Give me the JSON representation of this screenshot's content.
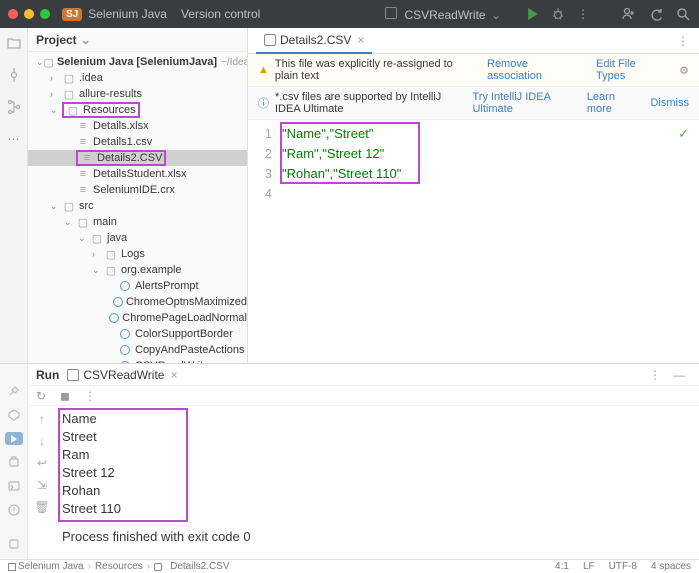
{
  "titlebar": {
    "badge": "SJ",
    "project": "Selenium Java",
    "vcs": "Version control",
    "run_config": "CSVReadWrite"
  },
  "project": {
    "header": "Project",
    "root_name": "Selenium Java",
    "root_module": "[SeleniumJava]",
    "root_path": "~/IdeaProjects/S",
    "tree": [
      {
        "lvl": 1,
        "arrow": ">",
        "type": "folder",
        "label": ".idea"
      },
      {
        "lvl": 1,
        "arrow": ">",
        "type": "folder",
        "label": "allure-results"
      },
      {
        "lvl": 1,
        "arrow": "v",
        "type": "folder",
        "label": "Resources",
        "hl": true
      },
      {
        "lvl": 2,
        "arrow": "",
        "type": "file",
        "label": "Details.xlsx"
      },
      {
        "lvl": 2,
        "arrow": "",
        "type": "file",
        "label": "Details1.csv"
      },
      {
        "lvl": 2,
        "arrow": "",
        "type": "file",
        "label": "Details2.CSV",
        "selected": true,
        "hl": true
      },
      {
        "lvl": 2,
        "arrow": "",
        "type": "file",
        "label": "DetailsStudent.xlsx"
      },
      {
        "lvl": 2,
        "arrow": "",
        "type": "file",
        "label": "SeleniumIDE.crx"
      },
      {
        "lvl": 1,
        "arrow": "v",
        "type": "folder",
        "label": "src"
      },
      {
        "lvl": 2,
        "arrow": "v",
        "type": "folder",
        "label": "main"
      },
      {
        "lvl": 3,
        "arrow": "v",
        "type": "folder",
        "label": "java"
      },
      {
        "lvl": 4,
        "arrow": ">",
        "type": "pkg",
        "label": "Logs"
      },
      {
        "lvl": 4,
        "arrow": "v",
        "type": "pkg",
        "label": "org.example"
      },
      {
        "lvl": 5,
        "arrow": "",
        "type": "java",
        "label": "AlertsPrompt"
      },
      {
        "lvl": 5,
        "arrow": "",
        "type": "java",
        "label": "ChromeOptnsMaximized"
      },
      {
        "lvl": 5,
        "arrow": "",
        "type": "java",
        "label": "ChromePageLoadNormal"
      },
      {
        "lvl": 5,
        "arrow": "",
        "type": "java",
        "label": "ColorSupportBorder"
      },
      {
        "lvl": 5,
        "arrow": "",
        "type": "java",
        "label": "CopyAndPasteActions"
      },
      {
        "lvl": 5,
        "arrow": "",
        "type": "java",
        "label": "CSVReadWrite"
      }
    ]
  },
  "editor": {
    "tab_name": "Details2.CSV",
    "banner_warn": "This file was explicitly re-assigned to plain text",
    "banner_warn_action1": "Remove association",
    "banner_warn_action2": "Edit File Types",
    "banner_info": "*.csv files are supported by IntelliJ IDEA Ultimate",
    "banner_info_action1": "Try IntelliJ IDEA Ultimate",
    "banner_info_action2": "Learn more",
    "banner_info_action3": "Dismiss",
    "gutters": [
      "1",
      "2",
      "3",
      "4"
    ],
    "lines": [
      "\"Name\",\"Street\"",
      "\"Ram\",\"Street 12\"",
      "\"Rohan\",\"Street 110\""
    ]
  },
  "run": {
    "header": "Run",
    "config": "CSVReadWrite",
    "console": [
      "Name",
      "Street",
      "Ram",
      "Street 12",
      "Rohan",
      "Street 110"
    ],
    "exit": "Process finished with exit code 0"
  },
  "status": {
    "crumbs": [
      "Selenium Java",
      "Resources",
      "Details2.CSV"
    ],
    "pos": "4:1",
    "le": "LF",
    "enc": "UTF-8",
    "indent": "4 spaces"
  }
}
